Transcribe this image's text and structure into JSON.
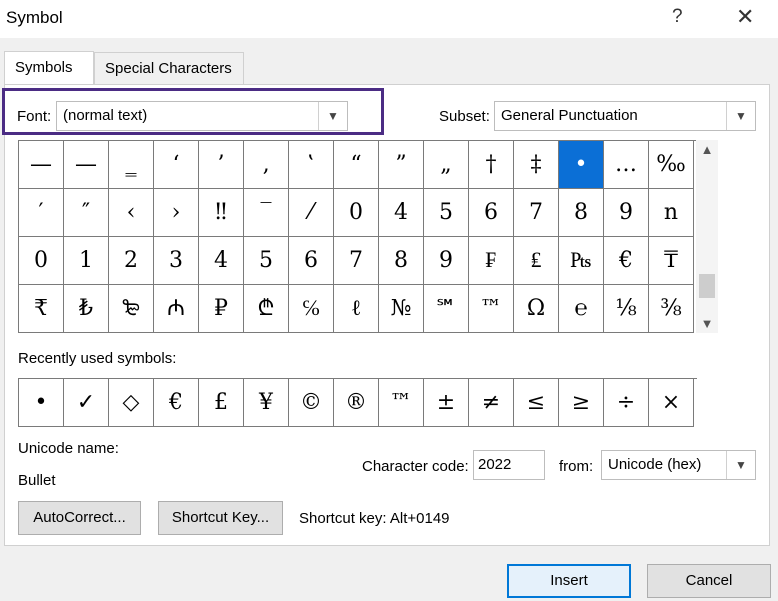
{
  "dialog": {
    "title": "Symbol",
    "help_glyph": "?",
    "close_glyph": "✕"
  },
  "tabs": [
    {
      "label": "Symbols",
      "active": true
    },
    {
      "label": "Special Characters",
      "active": false
    }
  ],
  "font": {
    "label": "Font:",
    "value": "(normal text)"
  },
  "subset": {
    "label": "Subset:",
    "value": "General Punctuation"
  },
  "symbol_grid": {
    "selected": "•",
    "rows": [
      [
        "—",
        "—",
        "‗",
        "‘",
        "’",
        "‚",
        "‛",
        "“",
        "”",
        "„",
        "†",
        "‡",
        "•",
        "…",
        "‰"
      ],
      [
        "′",
        "″",
        "‹",
        "›",
        "‼",
        "‾",
        "⁄",
        "0",
        "4",
        "5",
        "6",
        "7",
        "8",
        "9",
        "n"
      ],
      [
        "0",
        "1",
        "2",
        "3",
        "4",
        "5",
        "6",
        "7",
        "8",
        "9",
        "₣",
        "₤",
        "₧",
        "€",
        "₸"
      ],
      [
        "₹",
        "₺",
        "₻",
        "₼",
        "₽",
        "₾",
        "℅",
        "ℓ",
        "№",
        "℠",
        "™",
        "Ω",
        "℮",
        "⅛",
        "⅜"
      ]
    ]
  },
  "recent": {
    "label": "Recently used symbols:",
    "symbols": [
      "•",
      "✓",
      "◇",
      "€",
      "£",
      "¥",
      "©",
      "®",
      "™",
      "±",
      "≠",
      "≤",
      "≥",
      "÷",
      "×"
    ]
  },
  "unicode_name": {
    "label": "Unicode name:",
    "value": "Bullet"
  },
  "character_code": {
    "label": "Character code:",
    "value": "2022"
  },
  "from": {
    "label": "from:",
    "value": "Unicode (hex)"
  },
  "buttons": {
    "autocorrect": "AutoCorrect...",
    "shortcut_key": "Shortcut Key...",
    "insert": "Insert",
    "cancel": "Cancel"
  },
  "shortcut_key_text": "Shortcut key: Alt+0149",
  "icons": {
    "dropdown": "chevron-down-icon",
    "scroll_up": "chevron-up-icon",
    "scroll_down": "chevron-down-icon"
  },
  "colors": {
    "selection": "#0b6fd6",
    "highlight": "#4b2c84",
    "primary_border": "#0078d7"
  }
}
